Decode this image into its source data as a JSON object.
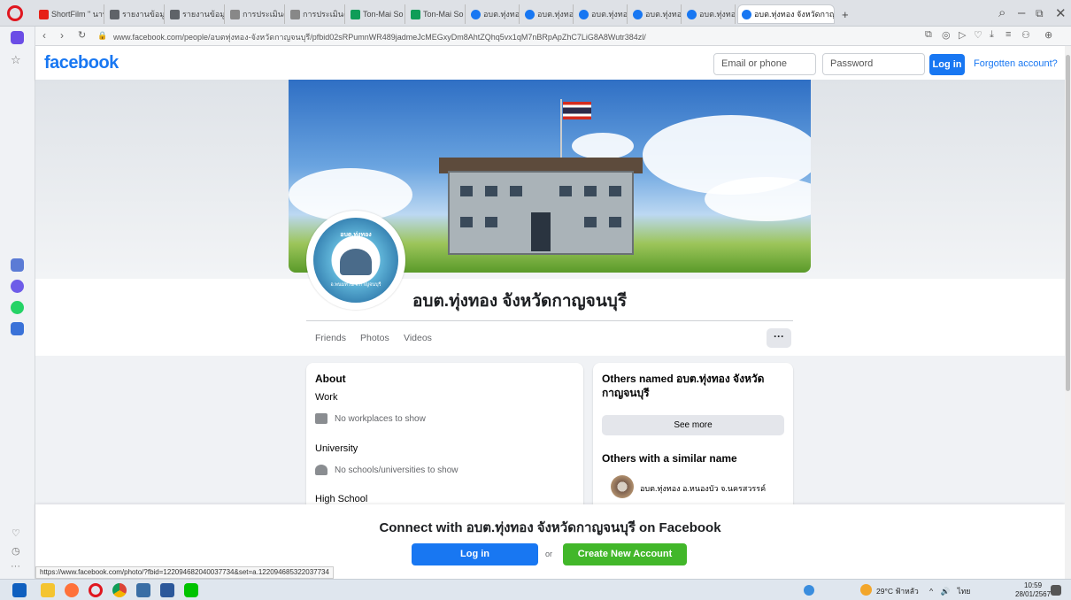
{
  "browser": {
    "tabs": [
      {
        "label": "ShortFilm \" นาทีฯ",
        "icon": "youtube-icon",
        "color": "#e62117"
      },
      {
        "label": "รายงานข้อมูลสถิติฯ",
        "icon": "doc-icon",
        "color": "#5f6368"
      },
      {
        "label": "รายงานข้อมูลสถิติฯ",
        "icon": "doc-icon",
        "color": "#5f6368"
      },
      {
        "label": "การประเมินคุณภาพฯ",
        "icon": "gov-icon",
        "color": "#888888"
      },
      {
        "label": "การประเมินคุณภาพฯ",
        "icon": "gov-icon",
        "color": "#888888"
      },
      {
        "label": "Ton-Mai So Cor",
        "icon": "sheet-icon",
        "color": "#0f9d58"
      },
      {
        "label": "Ton-Mai So Cor",
        "icon": "sheet-icon",
        "color": "#0f9d58"
      },
      {
        "label": "อบต.ทุ่งทอง จังหวัด",
        "icon": "facebook-icon",
        "color": "#1877f2"
      },
      {
        "label": "อบต.ทุ่งทอง จังหวัด",
        "icon": "facebook-icon",
        "color": "#1877f2"
      },
      {
        "label": "อบต.ทุ่งทอง จังหวัด",
        "icon": "facebook-icon",
        "color": "#1877f2"
      },
      {
        "label": "อบต.ทุ่งทอง จังหวัด",
        "icon": "facebook-icon",
        "color": "#1877f2"
      },
      {
        "label": "อบต.ทุ่งทอง จังหวัด",
        "icon": "facebook-icon",
        "color": "#1877f2"
      },
      {
        "label": "อบต.ทุ่งทอง จังหวัดกาญจนบุรี",
        "icon": "facebook-icon",
        "color": "#1877f2",
        "active": true
      }
    ],
    "url": "www.facebook.com/people/อบตทุ่งทอง-จังหวัดกาญจนบุรี/pfbid02sRPumnWR489jadmeJcMEGxyDm8AhtZQhq5vx1qM7nBRpApZhC7LiG8A8Wutr384zl/",
    "status_url": "https://www.facebook.com/photo/?fbid=122094682040037734&set=a.122094685322037734"
  },
  "header": {
    "logo": "facebook",
    "email_placeholder": "Email or phone",
    "password_placeholder": "Password",
    "login_label": "Log in",
    "forgot_label": "Forgotten account?"
  },
  "profile": {
    "name": "อบต.ทุ่งทอง จังหวัดกาญจนบุรี",
    "tabs": [
      "Friends",
      "Photos",
      "Videos"
    ],
    "more_label": "···",
    "avatar_text_top": "อบต.ทุ่งทอง",
    "avatar_text_bottom": "อ.พนมทวน จ.กาญจนบุรี"
  },
  "about": {
    "title": "About",
    "work_title": "Work",
    "work_text": "No workplaces to show",
    "university_title": "University",
    "university_text": "No schools/universities to show",
    "highschool_title": "High School"
  },
  "others": {
    "named_title": "Others named อบต.ทุ่งทอง จังหวัดกาญจนบุรี",
    "see_more": "See more",
    "similar_title": "Others with a similar name",
    "similar_item": "อบต.ทุ่งทอง อ.หนองบัว จ.นครสวรรค์"
  },
  "connect": {
    "text": "Connect with อบต.ทุ่งทอง จังหวัดกาญจนบุรี on Facebook",
    "login": "Log in",
    "or": "or",
    "create": "Create New Account"
  },
  "taskbar": {
    "weather": "29°C ฟ้าหลัว",
    "lang": "ไทย",
    "time": "10:59",
    "date": "28/01/2567"
  },
  "colors": {
    "fb_blue": "#1877f2",
    "fb_green": "#42b72a",
    "background": "#f0f2f5"
  }
}
